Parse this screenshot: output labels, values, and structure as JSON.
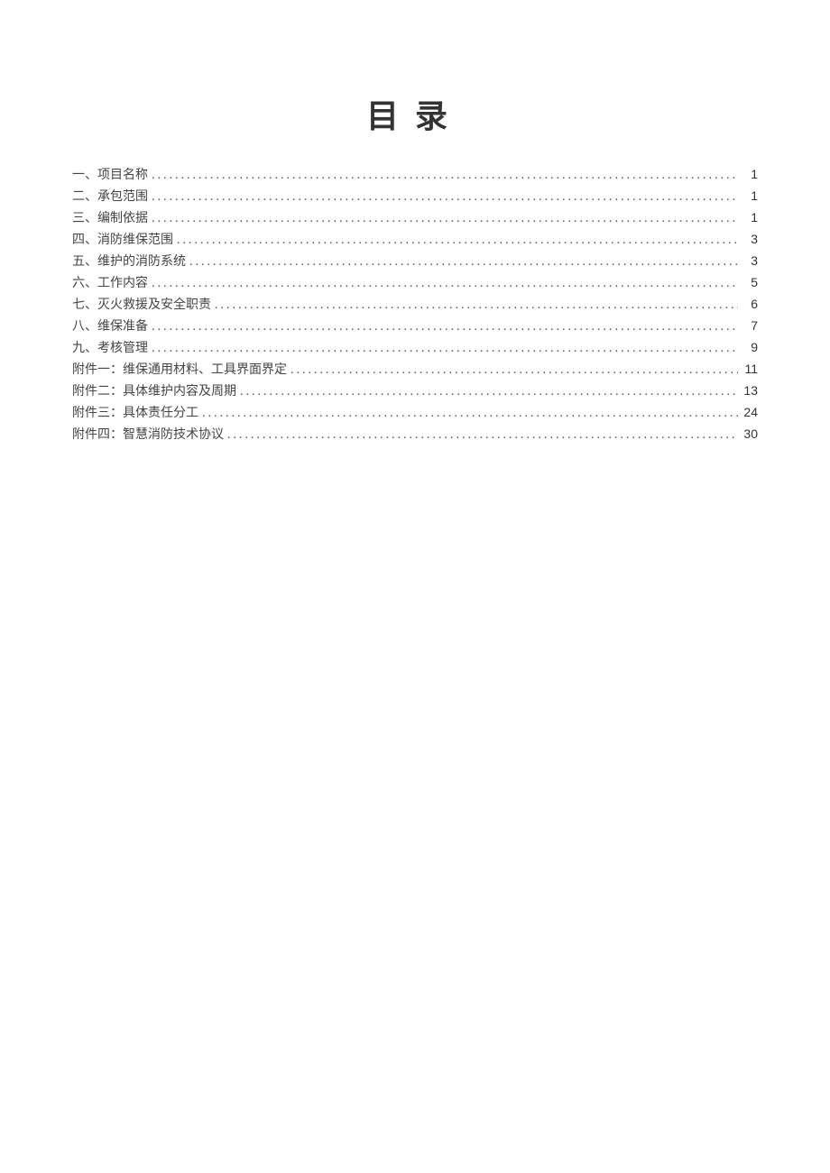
{
  "title": "目录",
  "toc": [
    {
      "label": "一、项目名称",
      "page": "1"
    },
    {
      "label": "二、承包范围",
      "page": "1"
    },
    {
      "label": "三、编制依据",
      "page": "1"
    },
    {
      "label": "四、消防维保范围",
      "page": "3"
    },
    {
      "label": "五、维护的消防系统",
      "page": "3"
    },
    {
      "label": "六、工作内容",
      "page": "5"
    },
    {
      "label": "七、灭火救援及安全职责",
      "page": "6"
    },
    {
      "label": "八、维保准备",
      "page": "7"
    },
    {
      "label": "九、考核管理",
      "page": "9"
    },
    {
      "label": "附件一：维保通用材料、工具界面界定",
      "page": "11"
    },
    {
      "label": "附件二：具体维护内容及周期",
      "page": "13"
    },
    {
      "label": "附件三：具体责任分工",
      "page": "24"
    },
    {
      "label": "附件四：智慧消防技术协议",
      "page": "30"
    }
  ]
}
